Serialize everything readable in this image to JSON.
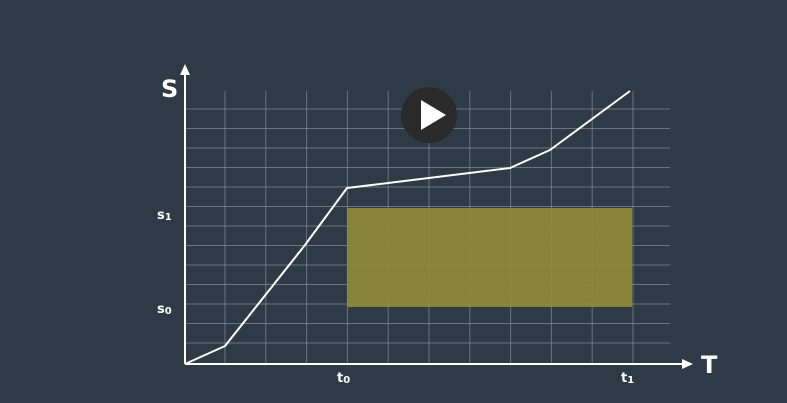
{
  "axes": {
    "y_label": "S",
    "x_label": "T"
  },
  "y_ticks": [
    {
      "main": "s",
      "sub": "1"
    },
    {
      "main": "s",
      "sub": "0"
    }
  ],
  "x_ticks": [
    {
      "main": "t",
      "sub": "0"
    },
    {
      "main": "t",
      "sub": "1"
    }
  ],
  "colors": {
    "background": "#2e3b47",
    "grid": "#7f8790",
    "curve": "#ffffff",
    "region": "#8f8a3a",
    "play_button": "#2a2a2a"
  },
  "icons": {
    "play": "play-icon"
  }
}
